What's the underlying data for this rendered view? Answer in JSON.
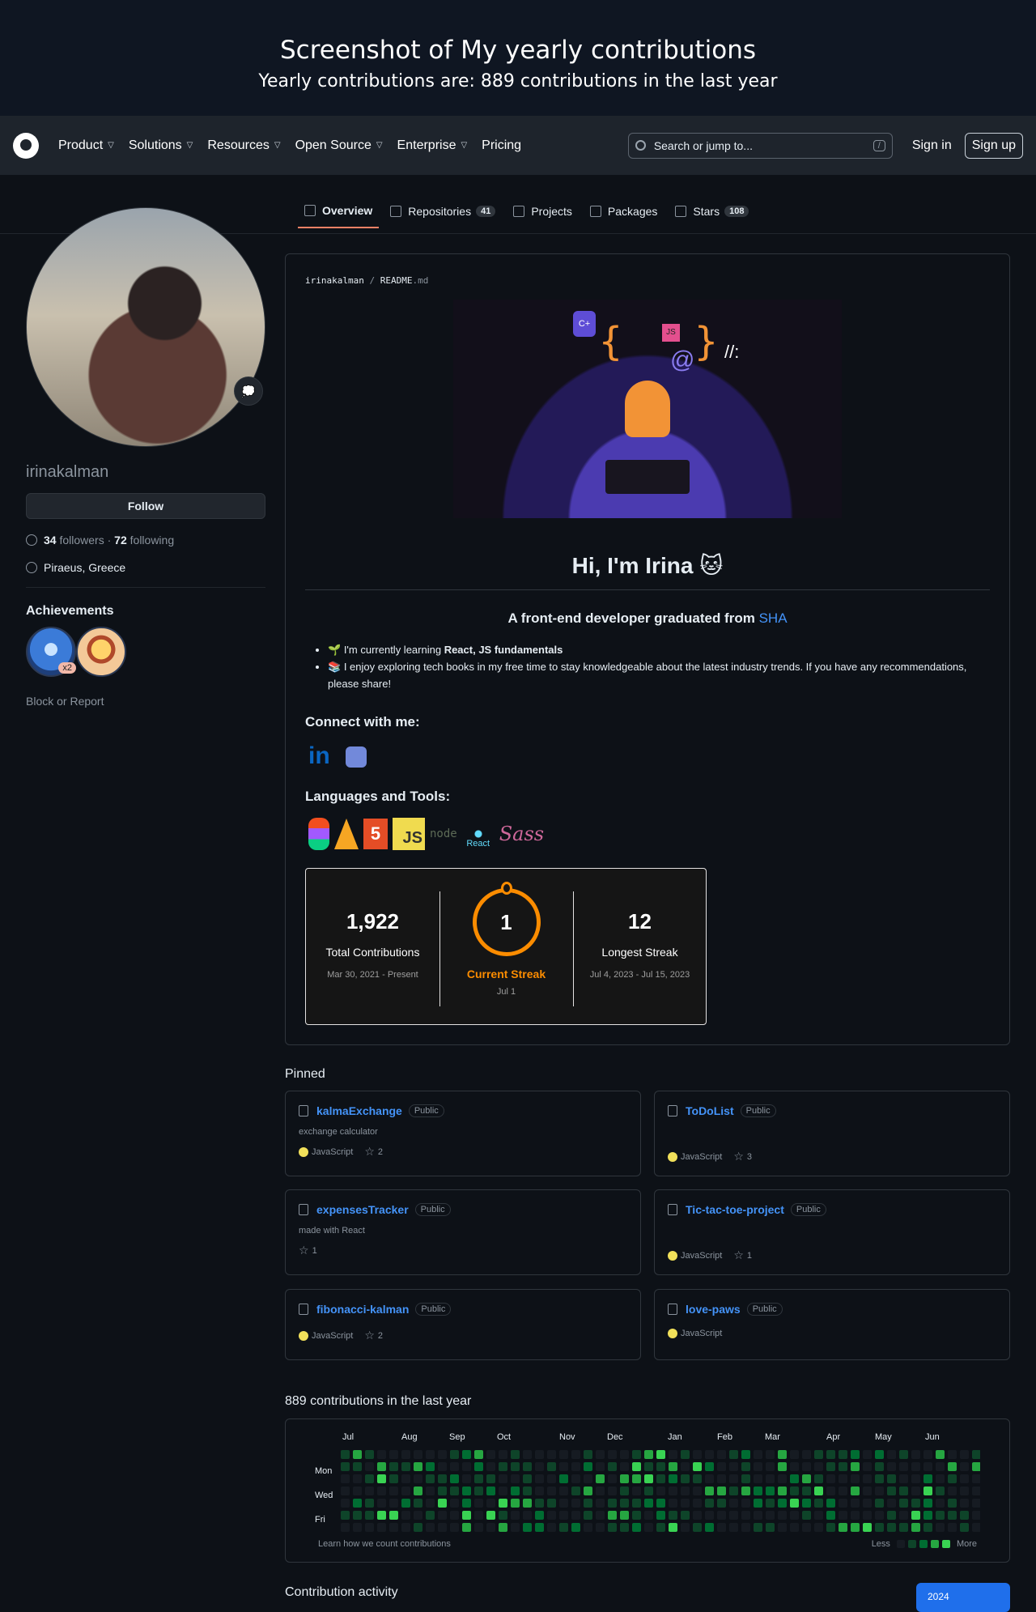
{
  "banner": {
    "title": "Screenshot of My yearly contributions",
    "subtitle": "Yearly contributions are: 889 contributions in the last year"
  },
  "nav": {
    "items": [
      "Product",
      "Solutions",
      "Resources",
      "Open Source",
      "Enterprise",
      "Pricing"
    ],
    "search_placeholder": "Search or jump to...",
    "search_shortcut": "/",
    "sign_in": "Sign in",
    "sign_up": "Sign up"
  },
  "tabs": [
    {
      "label": "Overview",
      "count": ""
    },
    {
      "label": "Repositories",
      "count": "41"
    },
    {
      "label": "Projects",
      "count": ""
    },
    {
      "label": "Packages",
      "count": ""
    },
    {
      "label": "Stars",
      "count": "108"
    }
  ],
  "profile": {
    "status_emoji": "💭",
    "username": "irinakalman",
    "follow_label": "Follow",
    "followers": "34",
    "followers_label": "followers",
    "following": "72",
    "following_label": "following",
    "location": "Piraeus, Greece",
    "achievements_title": "Achievements",
    "achievement_multiplier": "x2",
    "block_report": "Block or Report"
  },
  "readme": {
    "owner": "irinakalman",
    "sep": "/",
    "file": "README",
    "ext": ".md",
    "hero_labels": {
      "cpp": "C+",
      "js": "JS",
      "at": "@",
      "slashes": "//:"
    },
    "greeting": "Hi, I'm Irina",
    "greeting_emoji": "🐱",
    "tagline": "A front-end developer graduated from",
    "tagline_link": "SHA",
    "bullet1_emoji": "🌱",
    "bullet1_prefix": "I'm currently learning",
    "bullet1_bold": "React, JS fundamentals",
    "bullet2_emoji": "📚",
    "bullet2_text": "I enjoy exploring tech books in my free time to stay knowledgeable about the latest industry trends. If you have any recommendations, please share!",
    "connect_title": "Connect with me:",
    "linkedin_glyph": "in",
    "tools_title": "Languages and Tools:",
    "tool_labels": {
      "html": "5",
      "js": "JS",
      "node": "node",
      "react": "React",
      "sass": "Sass"
    }
  },
  "stats": {
    "total": "1,922",
    "total_label": "Total Contributions",
    "total_range": "Mar 30, 2021 - Present",
    "current": "1",
    "current_label": "Current Streak",
    "current_range": "Jul 1",
    "longest": "12",
    "longest_label": "Longest Streak",
    "longest_range": "Jul 4, 2023 - Jul 15, 2023"
  },
  "pinned_title": "Pinned",
  "pinned": [
    {
      "name": "kalmaExchange",
      "badge": "Public",
      "desc": "exchange calculator",
      "lang": "JavaScript",
      "stars": "2"
    },
    {
      "name": "ToDoList",
      "badge": "Public",
      "desc": "",
      "lang": "JavaScript",
      "stars": "3"
    },
    {
      "name": "expensesTracker",
      "badge": "Public",
      "desc": "made with React",
      "lang": "",
      "stars": "1"
    },
    {
      "name": "Tic-tac-toe-project",
      "badge": "Public",
      "desc": "",
      "lang": "JavaScript",
      "stars": "1"
    },
    {
      "name": "fibonacci-kalman",
      "badge": "Public",
      "desc": "",
      "lang": "JavaScript",
      "stars": "2"
    },
    {
      "name": "love-paws",
      "badge": "Public",
      "desc": "",
      "lang": "JavaScript",
      "stars": ""
    }
  ],
  "contrib": {
    "title": "889 contributions in the last year",
    "months": [
      "Jul",
      "Aug",
      "Sep",
      "Oct",
      "Nov",
      "Dec",
      "Jan",
      "Feb",
      "Mar",
      "Apr",
      "May",
      "Jun"
    ],
    "days": [
      "Mon",
      "Wed",
      "Fri"
    ],
    "learn": "Learn how we count contributions",
    "less": "Less",
    "more": "More",
    "colors": [
      "#161b22",
      "#0e4429",
      "#006d32",
      "#26a641",
      "#39d353"
    ]
  },
  "activity_title": "Contribution activity",
  "year_selected": "2024"
}
